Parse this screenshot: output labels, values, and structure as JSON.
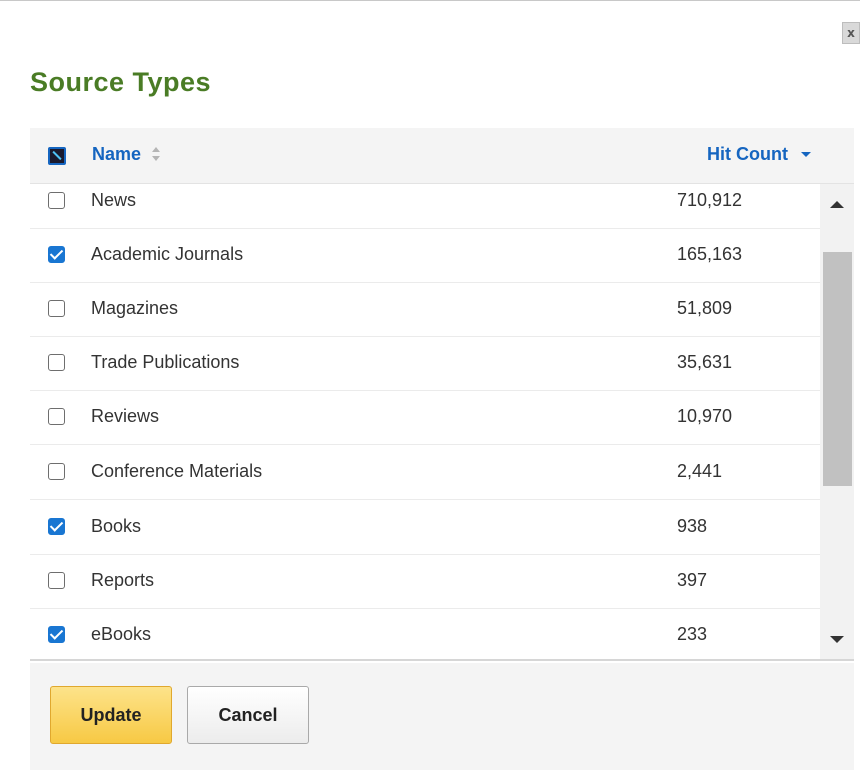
{
  "dialog": {
    "title": "Source Types",
    "close_label": "x"
  },
  "table": {
    "columns": {
      "name": "Name",
      "hits": "Hit Count"
    },
    "rows": [
      {
        "name": "News",
        "hits": "710,912",
        "checked": false
      },
      {
        "name": "Academic Journals",
        "hits": "165,163",
        "checked": true
      },
      {
        "name": "Magazines",
        "hits": "51,809",
        "checked": false
      },
      {
        "name": "Trade Publications",
        "hits": "35,631",
        "checked": false
      },
      {
        "name": "Reviews",
        "hits": "10,970",
        "checked": false
      },
      {
        "name": "Conference Materials",
        "hits": "2,441",
        "checked": false
      },
      {
        "name": "Books",
        "hits": "938",
        "checked": true
      },
      {
        "name": "Reports",
        "hits": "397",
        "checked": false
      },
      {
        "name": "eBooks",
        "hits": "233",
        "checked": true
      }
    ]
  },
  "footer": {
    "update_label": "Update",
    "cancel_label": "Cancel"
  },
  "colors": {
    "title": "#4a7c25",
    "link": "#1565c0",
    "checkbox_checked": "#1976d2",
    "update_button": "#f7c944"
  }
}
